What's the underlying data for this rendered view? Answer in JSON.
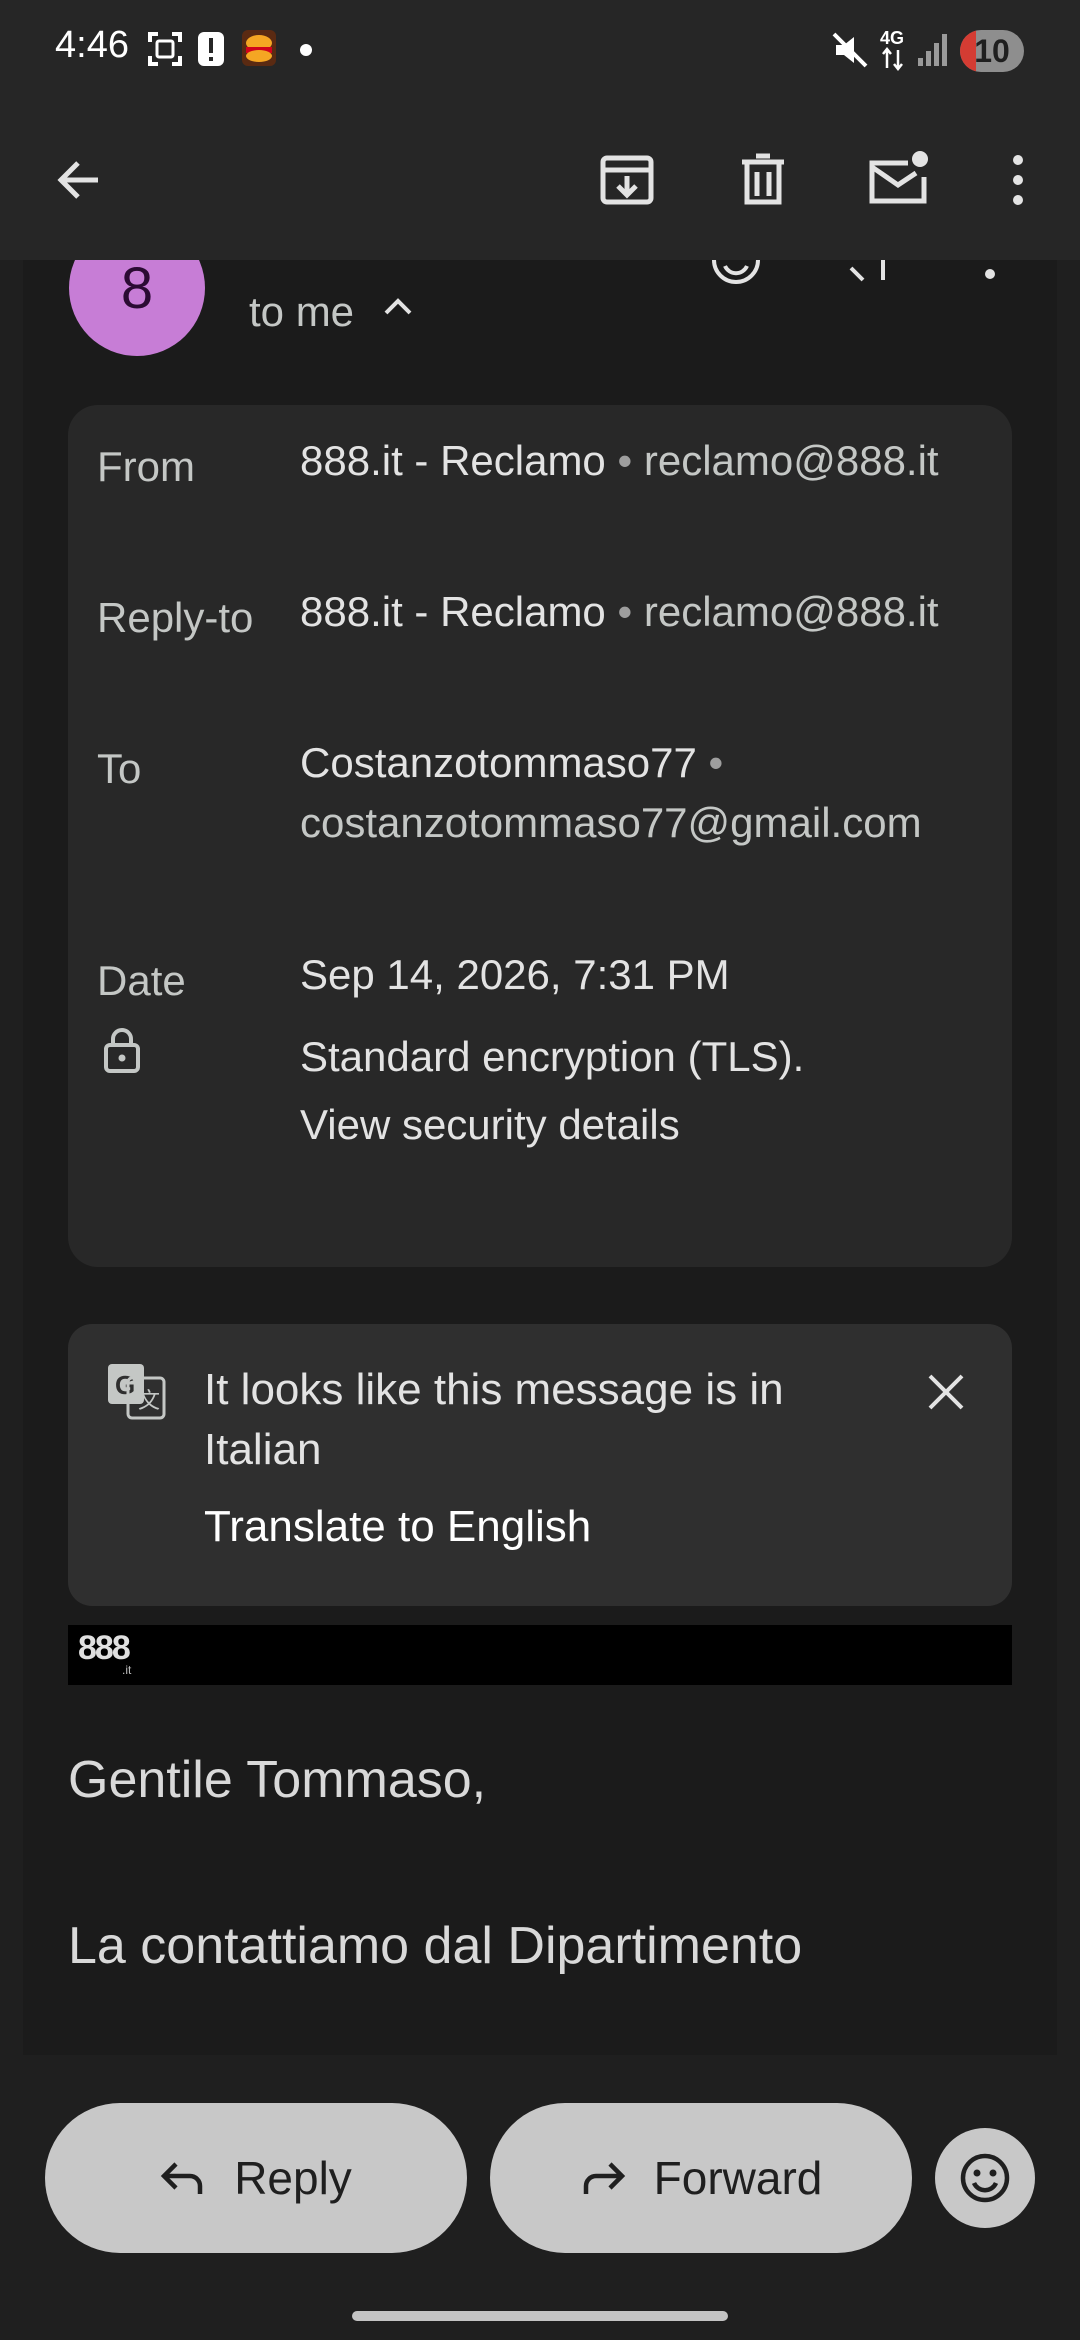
{
  "status_bar": {
    "time": "4:46",
    "network": "4G",
    "battery": "10"
  },
  "sender": {
    "avatar_letter": "8",
    "to_summary": "to me"
  },
  "details": {
    "from_label": "From",
    "from_name": "888.it - Reclamo",
    "from_email": "reclamo@888.it",
    "reply_to_label": "Reply-to",
    "reply_to_name": "888.it - Reclamo",
    "reply_to_email": "reclamo@888.it",
    "to_label": "To",
    "to_name": "Costanzotommaso77",
    "to_email": "costanzotommaso77@gmail.com",
    "date_label": "Date",
    "date_value": "Sep 14, 2026, 7:31 PM",
    "security_text": "Standard encryption (TLS).",
    "security_link": "View security details"
  },
  "translate": {
    "message": "It looks like this message is in Italian",
    "action": "Translate to English"
  },
  "email_body": {
    "logo_text": "888",
    "logo_sub": ".it",
    "greeting": "Gentile Tommaso,",
    "line1": "La contattiamo dal Dipartimento"
  },
  "actions": {
    "reply": "Reply",
    "forward": "Forward"
  }
}
